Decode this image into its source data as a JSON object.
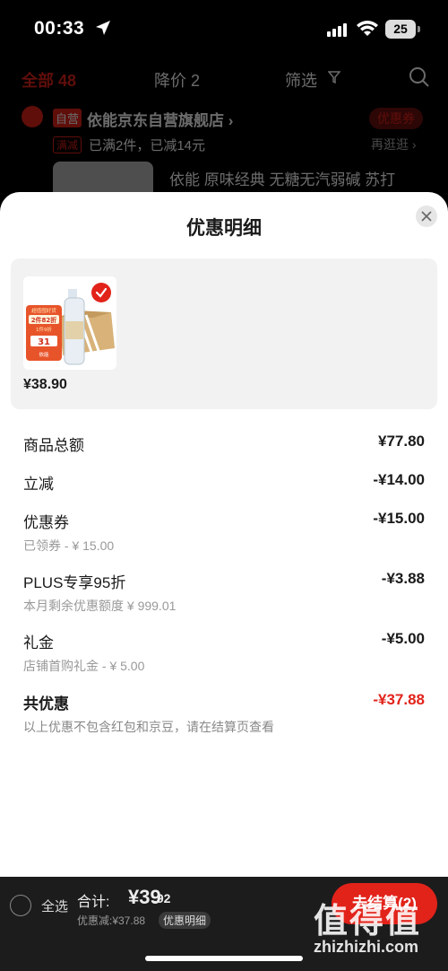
{
  "status_bar": {
    "time": "00:33",
    "battery": "25"
  },
  "background_page": {
    "tabs": [
      "全部 48",
      "降价 2",
      "筛选"
    ],
    "self_operated_badge": "自营",
    "store_name": "依能京东自营旗舰店 ›",
    "coupon_button": "优惠券",
    "promo_badge": "满减",
    "promo_text": "已满2件，已减14元",
    "more_link": "再逛逛 ›",
    "product_title": "依能 原味经典 无糖无汽弱碱 苏打"
  },
  "sheet": {
    "title": "优惠明细",
    "product": {
      "price": "¥38.90",
      "thumb_text": {
        "line1": "超值囤好货",
        "line2": "2件82折",
        "line3": "1件9折",
        "line4": "31",
        "line5": "依能"
      }
    },
    "rows": [
      {
        "label": "商品总额",
        "value": "¥77.80",
        "sub": ""
      },
      {
        "label": "立减",
        "value": "-¥14.00",
        "sub": ""
      },
      {
        "label": "优惠券",
        "value": "-¥15.00",
        "sub": "已领券 - ¥ 15.00"
      },
      {
        "label": "PLUS专享95折",
        "value": "-¥3.88",
        "sub": "本月剩余优惠额度 ¥ 999.01"
      },
      {
        "label": "礼金",
        "value": "-¥5.00",
        "sub": "店铺首购礼金 - ¥ 5.00"
      }
    ],
    "total": {
      "label": "共优惠",
      "value": "-¥37.88"
    },
    "note": "以上优惠不包含红包和京豆，请在结算页查看"
  },
  "checkout_bar": {
    "select_all": "全选",
    "total_prefix": "合计:",
    "total_amount": "¥39",
    "total_decimal": ".92",
    "discount_line": "优惠减:¥37.88",
    "detail_chip": "优惠明细",
    "checkout_button": "去结算(2)"
  },
  "watermark": {
    "logo": "值得值",
    "site": "zhizhizhi.com"
  },
  "colors": {
    "accent": "#e2231a",
    "sheet_bg": "#ffffff",
    "bar_bg": "#1c1c1c"
  }
}
